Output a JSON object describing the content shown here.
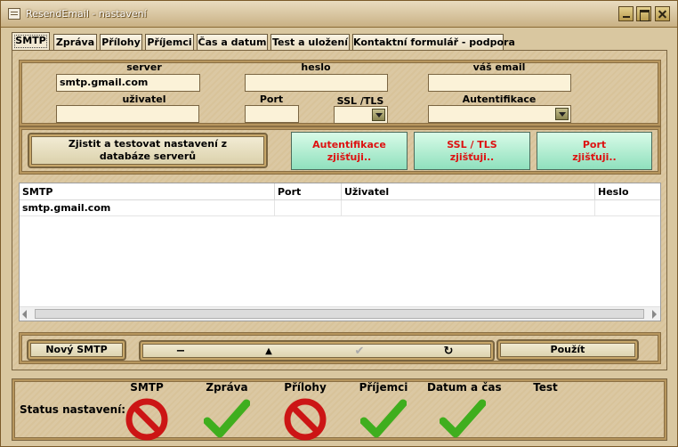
{
  "window": {
    "title": "ResendEmail - nastavení"
  },
  "tabs": [
    {
      "label": "SMTP",
      "active": true
    },
    {
      "label": "Zpráva"
    },
    {
      "label": "Přílohy"
    },
    {
      "label": "Příjemci"
    },
    {
      "label": "Čas a datum"
    },
    {
      "label": "Test a uložení"
    },
    {
      "label": "Kontaktní formulář - podpora"
    }
  ],
  "smtp_form": {
    "server_label": "server",
    "server_value": "smtp.gmail.com",
    "password_label": "heslo",
    "password_value": "",
    "email_label": "váš email",
    "email_value": "",
    "user_label": "uživatel",
    "user_value": "",
    "port_label": "Port",
    "port_value": "",
    "ssl_label": "SSL /TLS",
    "ssl_value": "",
    "auth_label": "Autentifikace",
    "auth_value": ""
  },
  "detect": {
    "test_button": "Zjistit a testovat nastavení z databáze serverů",
    "auth_button": "Autentifikace zjišťuji..",
    "ssl_button": "SSL / TLS zjišťuji..",
    "port_button": "Port zjišťuji.."
  },
  "server_table": {
    "columns": [
      "SMTP",
      "Port",
      "Uživatel",
      "Heslo"
    ],
    "rows": [
      [
        "smtp.gmail.com",
        "",
        "",
        ""
      ]
    ]
  },
  "actions": {
    "new_smtp": "Nový SMTP",
    "delete_glyph": "−",
    "up_glyph": "▲",
    "confirm_glyph": "✔",
    "refresh_glyph": "↻",
    "apply": "Použít"
  },
  "status": {
    "label": "Status nastavení:",
    "items": [
      {
        "name": "SMTP",
        "state": "error"
      },
      {
        "name": "Zpráva",
        "state": "ok"
      },
      {
        "name": "Přílohy",
        "state": "error"
      },
      {
        "name": "Příjemci",
        "state": "ok"
      },
      {
        "name": "Datum a čas",
        "state": "ok"
      },
      {
        "name": "Test",
        "state": "none"
      }
    ]
  },
  "colors": {
    "error": "#cc1515",
    "ok": "#3fae1e",
    "detect_text": "#dd1111"
  }
}
